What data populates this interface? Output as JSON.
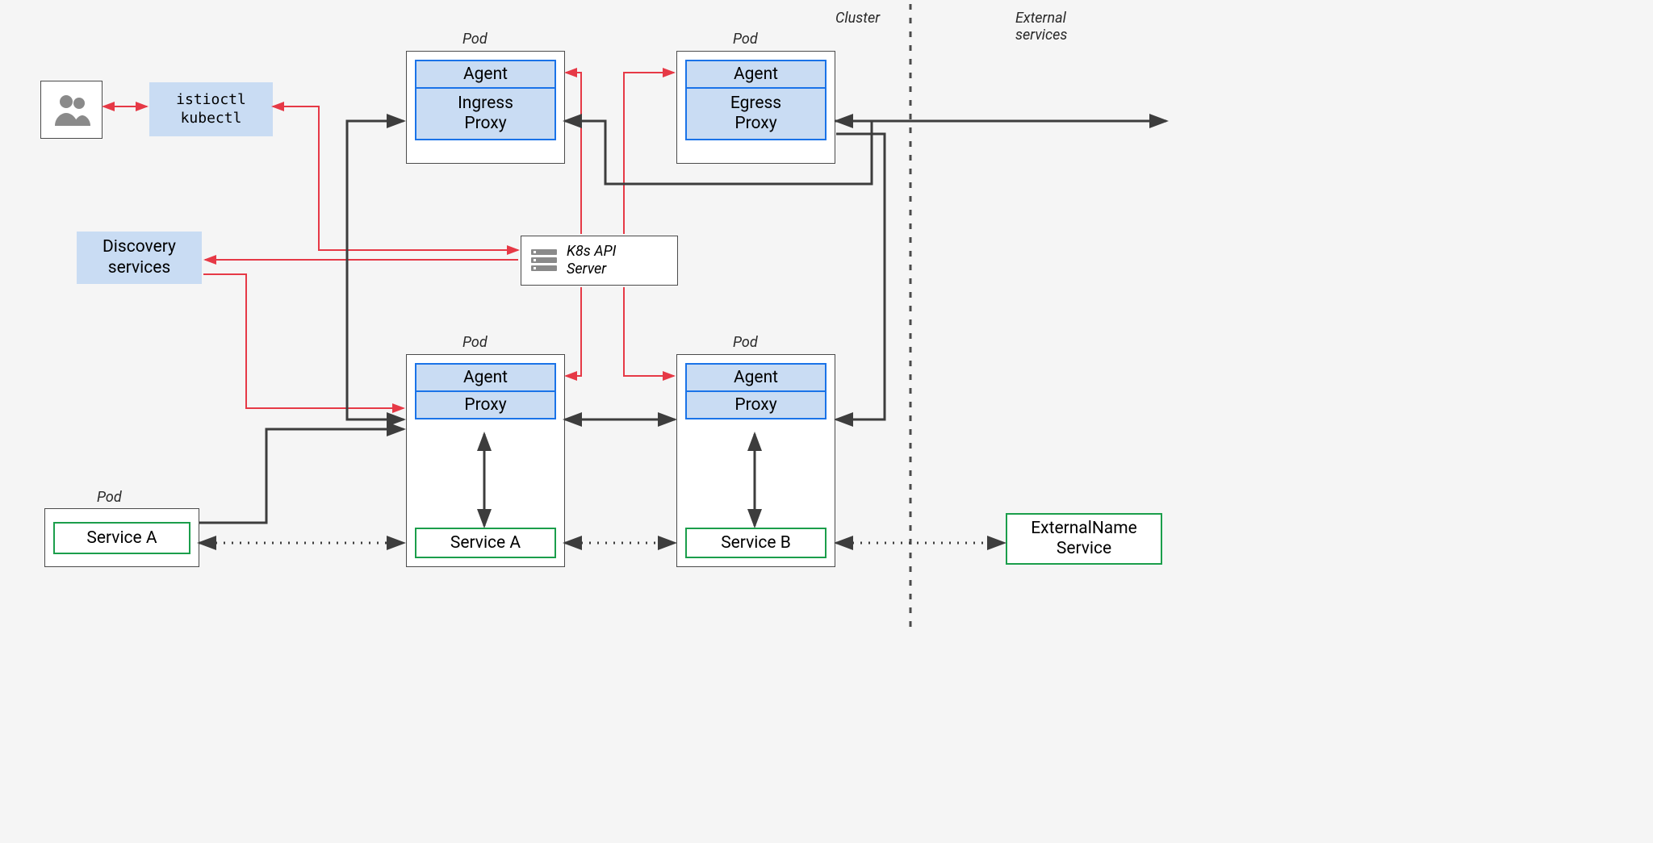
{
  "section_labels": {
    "cluster": "Cluster",
    "external": "External\nservices"
  },
  "pod_label": "Pod",
  "cli": {
    "line1": "istioctl",
    "line2": "kubectl"
  },
  "discovery": "Discovery\nservices",
  "api_server": "K8s API\nServer",
  "ingress": {
    "agent": "Agent",
    "proxy": "Ingress\nProxy"
  },
  "egress": {
    "agent": "Agent",
    "proxy": "Egress\nProxy"
  },
  "sidecarA": {
    "agent": "Agent",
    "proxy": "Proxy",
    "service": "Service A"
  },
  "sidecarB": {
    "agent": "Agent",
    "proxy": "Proxy",
    "service": "Service B"
  },
  "outer_service": "Service A",
  "external_service": "ExternalName\nService",
  "colors": {
    "red": "#e63946",
    "dark": "#3d3d3d",
    "blue": "#1a73e8",
    "green": "#1b9e4b"
  }
}
